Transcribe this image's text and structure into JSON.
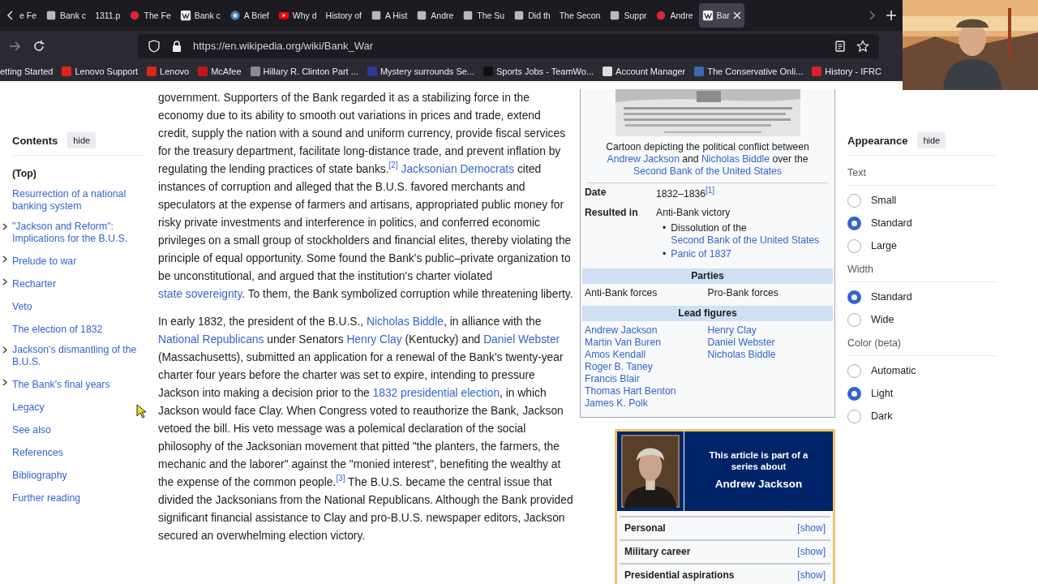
{
  "browser": {
    "tabs": [
      {
        "title": "e Fe",
        "kind": "plain",
        "selected": false
      },
      {
        "title": "Bank c",
        "kind": "square",
        "selected": false
      },
      {
        "title": "1311.p",
        "kind": "plain",
        "selected": false
      },
      {
        "title": "The Fe",
        "kind": "dot",
        "selected": false
      },
      {
        "title": "Bank c",
        "kind": "wiki",
        "selected": false
      },
      {
        "title": "A Brief",
        "kind": "globe",
        "selected": false
      },
      {
        "title": "Why d",
        "kind": "video",
        "selected": false
      },
      {
        "title": "History of",
        "kind": "plain",
        "selected": false
      },
      {
        "title": "A Hist",
        "kind": "square",
        "selected": false
      },
      {
        "title": "Andre",
        "kind": "square",
        "selected": false
      },
      {
        "title": "The Su",
        "kind": "square",
        "selected": false
      },
      {
        "title": "Did th",
        "kind": "square",
        "selected": false
      },
      {
        "title": "The Secon",
        "kind": "plain",
        "selected": false
      },
      {
        "title": "Suppr",
        "kind": "square",
        "selected": false
      },
      {
        "title": "Andre",
        "kind": "dot",
        "selected": false
      },
      {
        "title": "Bar",
        "kind": "wiki",
        "selected": true
      }
    ],
    "url": "https://en.wikipedia.org/wiki/Bank_War",
    "bookmarks": [
      {
        "label": "etting Started"
      },
      {
        "label": "Lenovo Support",
        "color": "#e2231a"
      },
      {
        "label": "Lenovo",
        "color": "#e2231a"
      },
      {
        "label": "McAfee",
        "color": "#c01818"
      },
      {
        "label": "Hillary R. Clinton Part ...",
        "color": "#8a8a9a"
      },
      {
        "label": "Mystery surrounds Se...",
        "color": "#2a3a9a"
      },
      {
        "label": "Sports Jobs - TeamWo...",
        "color": "#111111"
      },
      {
        "label": "Account Manager",
        "color": "#dddddd"
      },
      {
        "label": "The Conservative Onli...",
        "color": "#3a6ab0"
      },
      {
        "label": "History - IFRC",
        "color": "#d8202a"
      }
    ]
  },
  "contents": {
    "heading": "Contents",
    "hide": "hide",
    "items": [
      {
        "label": "(Top)",
        "selected": true,
        "toggle": false
      },
      {
        "label": "Resurrection of a national banking system",
        "selected": false,
        "toggle": false
      },
      {
        "label": "\"Jackson and Reform\": Implications for the B.U.S.",
        "selected": false,
        "toggle": true
      },
      {
        "label": "Prelude to war",
        "selected": false,
        "toggle": true
      },
      {
        "label": "Recharter",
        "selected": false,
        "toggle": true
      },
      {
        "label": "Veto",
        "selected": false,
        "toggle": false
      },
      {
        "label": "The election of 1832",
        "selected": false,
        "toggle": false
      },
      {
        "label": "Jackson's dismantling of the B.U.S.",
        "selected": false,
        "toggle": true
      },
      {
        "label": "The Bank's final years",
        "selected": false,
        "toggle": true
      },
      {
        "label": "Legacy",
        "selected": false,
        "toggle": false
      },
      {
        "label": "See also",
        "selected": false,
        "toggle": false
      },
      {
        "label": "References",
        "selected": false,
        "toggle": false
      },
      {
        "label": "Bibliography",
        "selected": false,
        "toggle": false
      },
      {
        "label": "Further reading",
        "selected": false,
        "toggle": false
      }
    ]
  },
  "article": {
    "paragraphs": [
      [
        {
          "kind": "text",
          "text": "government. Supporters of the Bank regarded it as a stabilizing force in the economy due to its ability to smooth out variations in prices and trade, extend credit, supply the nation with a sound and uniform currency, provide fiscal services for the treasury department, facilitate long-distance trade, and prevent inflation by regulating the lending practices of state banks."
        },
        {
          "kind": "ref",
          "text": "[2]"
        },
        {
          "kind": "link",
          "text": "Jacksonian Democrats",
          "gap": true
        },
        {
          "kind": "text",
          "text": " cited instances of corruption and alleged that the B.U.S. favored merchants and speculators at the expense of farmers and artisans, appropriated public money for risky private investments and interference in politics, and conferred economic privileges on a small group of stockholders and financial elites, thereby violating the principle of equal opportunity. Some found the Bank's public–private organization to be unconstitutional, and argued that the institution's charter violated "
        },
        {
          "kind": "link",
          "text": "state sovereignty"
        },
        {
          "kind": "text",
          "text": ". To them, the Bank symbolized corruption while threatening liberty."
        }
      ],
      [
        {
          "kind": "text",
          "text": "In early 1832, the president of the B.U.S., "
        },
        {
          "kind": "link",
          "text": "Nicholas Biddle"
        },
        {
          "kind": "text",
          "text": ", in alliance with the "
        },
        {
          "kind": "link",
          "text": "National Republicans"
        },
        {
          "kind": "text",
          "text": " under Senators "
        },
        {
          "kind": "link",
          "text": "Henry Clay"
        },
        {
          "kind": "text",
          "text": " (Kentucky) and "
        },
        {
          "kind": "link",
          "text": "Daniel Webster"
        },
        {
          "kind": "text",
          "text": " (Massachusetts), submitted an application for a renewal of the Bank's twenty-year charter four years before the charter was set to expire, intending to pressure Jackson into making a decision prior to the "
        },
        {
          "kind": "link",
          "text": "1832 presidential election"
        },
        {
          "kind": "text",
          "text": ", in which Jackson would face Clay. When Congress voted to reauthorize the Bank, Jackson vetoed the bill. His veto message was a polemical declaration of the social philosophy of the Jacksonian movement that pitted \"the planters, the farmers, the mechanic and the laborer\" against the \"monied interest\", benefiting the wealthy at the expense of the common people."
        },
        {
          "kind": "ref",
          "text": "[3]"
        },
        {
          "kind": "text",
          "text": " The B.U.S. became the central issue that divided the Jacksonians from the National Republicans. Although the Bank provided significant financial assistance to Clay and pro-B.U.S. newspaper editors, Jackson secured an overwhelming election victory."
        }
      ]
    ]
  },
  "infobox": {
    "caption": [
      {
        "kind": "text",
        "text": "Cartoon depicting the political conflict between "
      },
      {
        "kind": "link",
        "text": "Andrew Jackson"
      },
      {
        "kind": "text",
        "text": " and "
      },
      {
        "kind": "link",
        "text": "Nicholas Biddle"
      },
      {
        "kind": "text",
        "text": " over the "
      },
      {
        "kind": "link",
        "text": "Second Bank of the United States"
      }
    ],
    "date": {
      "label": "Date",
      "value": "1832–1836",
      "ref": "[1]"
    },
    "result": {
      "label": "Resulted in",
      "value": "Anti-Bank victory",
      "bullets": [
        {
          "marker": "•",
          "parts": [
            {
              "kind": "text",
              "text": "Dissolution of the "
            },
            {
              "kind": "link",
              "text": "Second Bank of the United States"
            }
          ]
        },
        {
          "marker": "•",
          "parts": [
            {
              "kind": "link",
              "text": "Panic of 1837"
            }
          ]
        }
      ]
    },
    "parties": {
      "heading": "Parties",
      "left": "Anti-Bank forces",
      "right": "Pro-Bank forces"
    },
    "lead": {
      "heading": "Lead figures",
      "left": [
        "Andrew Jackson",
        "Martin Van Buren",
        "Amos Kendall",
        "Roger B. Taney",
        "Francis Blair",
        "Thomas Hart Benton",
        "James K. Polk"
      ],
      "right": [
        "Henry Clay",
        "Daniel Webster",
        "Nicholas Biddle"
      ]
    }
  },
  "series": {
    "intro": "This article is part of a series about",
    "subject": "Andrew Jackson",
    "sections": [
      {
        "label": "Personal",
        "toggle": "[show]"
      },
      {
        "label": "Military career",
        "toggle": "[show]"
      },
      {
        "label": "Presidential aspirations",
        "toggle": "[show]"
      }
    ]
  },
  "appearance": {
    "heading": "Appearance",
    "hide": "hide",
    "groups": [
      {
        "label": "Text",
        "options": [
          {
            "label": "Small",
            "selected": false
          },
          {
            "label": "Standard",
            "selected": true
          },
          {
            "label": "Large",
            "selected": false
          }
        ]
      },
      {
        "label": "Width",
        "options": [
          {
            "label": "Standard",
            "selected": true
          },
          {
            "label": "Wide",
            "selected": false
          }
        ]
      },
      {
        "label": "Color (beta)",
        "options": [
          {
            "label": "Automatic",
            "selected": false
          },
          {
            "label": "Light",
            "selected": true
          },
          {
            "label": "Dark",
            "selected": false
          }
        ]
      }
    ]
  }
}
